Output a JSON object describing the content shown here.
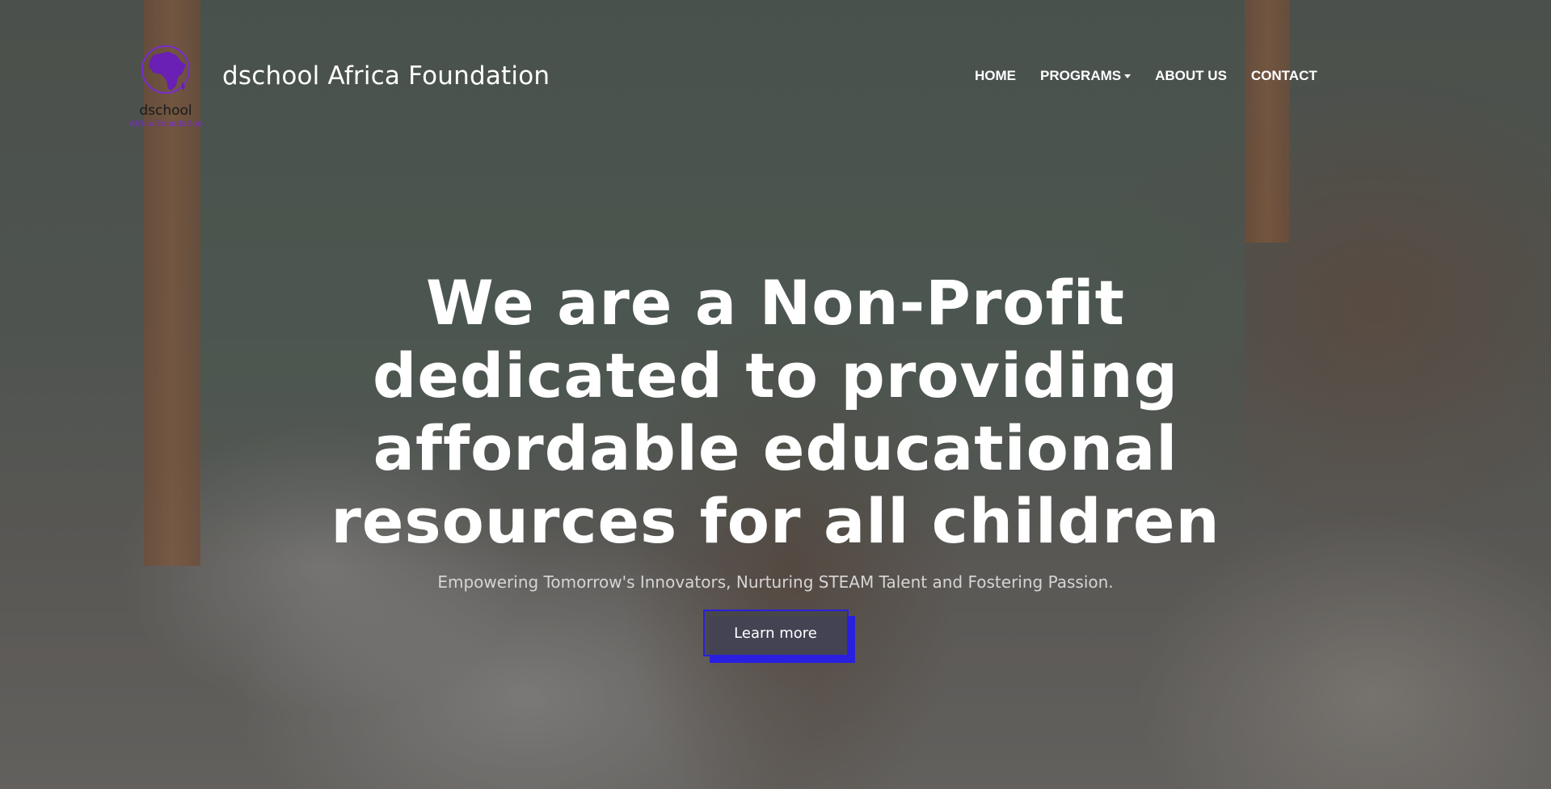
{
  "navbar": {
    "brand_name": "dschool Africa Foundation",
    "logo": {
      "icon": "africa-map-logo",
      "text_main": "dschool",
      "text_sub": "Africa Foundation",
      "color": "#6a1fb5"
    },
    "links": [
      {
        "label": "HOME"
      },
      {
        "label": "PROGRAMS",
        "dropdown": true
      },
      {
        "label": "ABOUT US"
      },
      {
        "label": "CONTACT"
      }
    ]
  },
  "hero": {
    "headline": "We are a Non-Profit dedicated to providing affordable educational resources for all children",
    "subtitle": "Empowering Tomorrow's Innovators, Nurturing STEAM Talent and Fostering Passion.",
    "cta_label": "Learn more",
    "cta_accent": "#2a1fe0"
  }
}
